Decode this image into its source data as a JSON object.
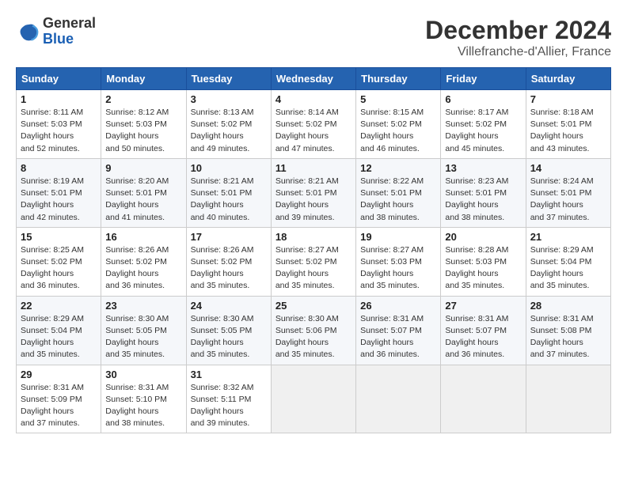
{
  "header": {
    "logo_general": "General",
    "logo_blue": "Blue",
    "month_title": "December 2024",
    "location": "Villefranche-d'Allier, France"
  },
  "weekdays": [
    "Sunday",
    "Monday",
    "Tuesday",
    "Wednesday",
    "Thursday",
    "Friday",
    "Saturday"
  ],
  "weeks": [
    [
      {
        "day": "1",
        "sunrise": "8:11 AM",
        "sunset": "5:03 PM",
        "daylight": "8 hours and 52 minutes."
      },
      {
        "day": "2",
        "sunrise": "8:12 AM",
        "sunset": "5:03 PM",
        "daylight": "8 hours and 50 minutes."
      },
      {
        "day": "3",
        "sunrise": "8:13 AM",
        "sunset": "5:02 PM",
        "daylight": "8 hours and 49 minutes."
      },
      {
        "day": "4",
        "sunrise": "8:14 AM",
        "sunset": "5:02 PM",
        "daylight": "8 hours and 47 minutes."
      },
      {
        "day": "5",
        "sunrise": "8:15 AM",
        "sunset": "5:02 PM",
        "daylight": "8 hours and 46 minutes."
      },
      {
        "day": "6",
        "sunrise": "8:17 AM",
        "sunset": "5:02 PM",
        "daylight": "8 hours and 45 minutes."
      },
      {
        "day": "7",
        "sunrise": "8:18 AM",
        "sunset": "5:01 PM",
        "daylight": "8 hours and 43 minutes."
      }
    ],
    [
      {
        "day": "8",
        "sunrise": "8:19 AM",
        "sunset": "5:01 PM",
        "daylight": "8 hours and 42 minutes."
      },
      {
        "day": "9",
        "sunrise": "8:20 AM",
        "sunset": "5:01 PM",
        "daylight": "8 hours and 41 minutes."
      },
      {
        "day": "10",
        "sunrise": "8:21 AM",
        "sunset": "5:01 PM",
        "daylight": "8 hours and 40 minutes."
      },
      {
        "day": "11",
        "sunrise": "8:21 AM",
        "sunset": "5:01 PM",
        "daylight": "8 hours and 39 minutes."
      },
      {
        "day": "12",
        "sunrise": "8:22 AM",
        "sunset": "5:01 PM",
        "daylight": "8 hours and 38 minutes."
      },
      {
        "day": "13",
        "sunrise": "8:23 AM",
        "sunset": "5:01 PM",
        "daylight": "8 hours and 38 minutes."
      },
      {
        "day": "14",
        "sunrise": "8:24 AM",
        "sunset": "5:01 PM",
        "daylight": "8 hours and 37 minutes."
      }
    ],
    [
      {
        "day": "15",
        "sunrise": "8:25 AM",
        "sunset": "5:02 PM",
        "daylight": "8 hours and 36 minutes."
      },
      {
        "day": "16",
        "sunrise": "8:26 AM",
        "sunset": "5:02 PM",
        "daylight": "8 hours and 36 minutes."
      },
      {
        "day": "17",
        "sunrise": "8:26 AM",
        "sunset": "5:02 PM",
        "daylight": "8 hours and 35 minutes."
      },
      {
        "day": "18",
        "sunrise": "8:27 AM",
        "sunset": "5:02 PM",
        "daylight": "8 hours and 35 minutes."
      },
      {
        "day": "19",
        "sunrise": "8:27 AM",
        "sunset": "5:03 PM",
        "daylight": "8 hours and 35 minutes."
      },
      {
        "day": "20",
        "sunrise": "8:28 AM",
        "sunset": "5:03 PM",
        "daylight": "8 hours and 35 minutes."
      },
      {
        "day": "21",
        "sunrise": "8:29 AM",
        "sunset": "5:04 PM",
        "daylight": "8 hours and 35 minutes."
      }
    ],
    [
      {
        "day": "22",
        "sunrise": "8:29 AM",
        "sunset": "5:04 PM",
        "daylight": "8 hours and 35 minutes."
      },
      {
        "day": "23",
        "sunrise": "8:30 AM",
        "sunset": "5:05 PM",
        "daylight": "8 hours and 35 minutes."
      },
      {
        "day": "24",
        "sunrise": "8:30 AM",
        "sunset": "5:05 PM",
        "daylight": "8 hours and 35 minutes."
      },
      {
        "day": "25",
        "sunrise": "8:30 AM",
        "sunset": "5:06 PM",
        "daylight": "8 hours and 35 minutes."
      },
      {
        "day": "26",
        "sunrise": "8:31 AM",
        "sunset": "5:07 PM",
        "daylight": "8 hours and 36 minutes."
      },
      {
        "day": "27",
        "sunrise": "8:31 AM",
        "sunset": "5:07 PM",
        "daylight": "8 hours and 36 minutes."
      },
      {
        "day": "28",
        "sunrise": "8:31 AM",
        "sunset": "5:08 PM",
        "daylight": "8 hours and 37 minutes."
      }
    ],
    [
      {
        "day": "29",
        "sunrise": "8:31 AM",
        "sunset": "5:09 PM",
        "daylight": "8 hours and 37 minutes."
      },
      {
        "day": "30",
        "sunrise": "8:31 AM",
        "sunset": "5:10 PM",
        "daylight": "8 hours and 38 minutes."
      },
      {
        "day": "31",
        "sunrise": "8:32 AM",
        "sunset": "5:11 PM",
        "daylight": "8 hours and 39 minutes."
      },
      null,
      null,
      null,
      null
    ]
  ],
  "labels": {
    "sunrise": "Sunrise:",
    "sunset": "Sunset:",
    "daylight": "Daylight hours"
  }
}
